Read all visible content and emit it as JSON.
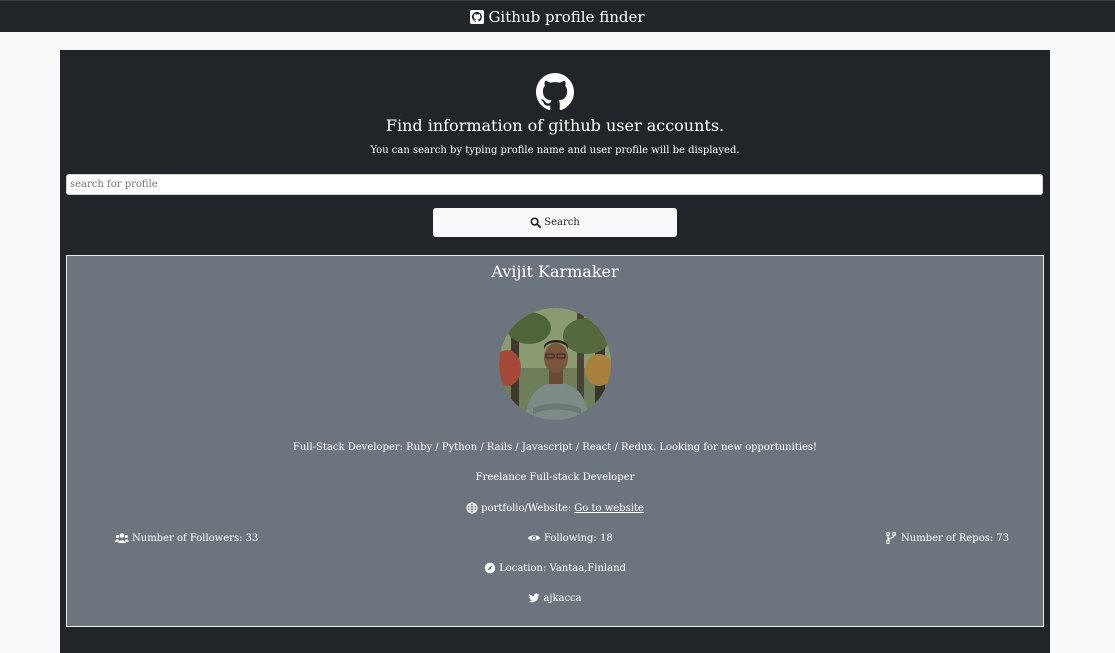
{
  "navbar": {
    "title": "Github profile finder",
    "icon": "github-icon"
  },
  "hero": {
    "headline": "Find information of github user accounts.",
    "subline": "You can search by typing profile name and user profile will be displayed."
  },
  "search": {
    "placeholder": "search for profile",
    "value": "",
    "button_label": "Search"
  },
  "profile": {
    "name": "Avijit Karmaker",
    "bio": "Full-Stack Developer: Ruby / Python / Rails / Javascript / React / Redux. Looking for new opportunities!",
    "title": "Freelance Full-stack Developer",
    "portfolio_label": "portfolio/Website:",
    "portfolio_link": "Go to website",
    "followers": "Number of Followers: 33",
    "following": "Following: 18",
    "repos": "Number of Repos: 73",
    "location": "Location: Vantaa,Finland",
    "twitter": "ajkacca"
  },
  "colors": {
    "dark": "#212529",
    "card": "#6c757d",
    "light": "#f8f9fa"
  }
}
